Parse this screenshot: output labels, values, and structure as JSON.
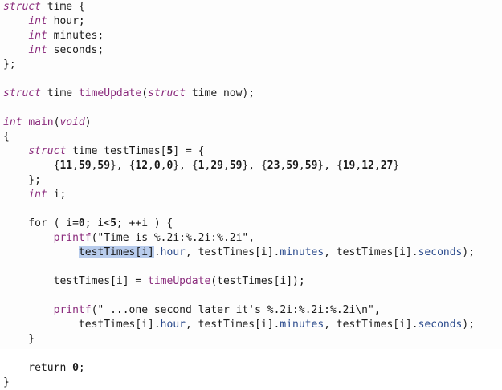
{
  "lines": [
    [
      {
        "t": "struct",
        "c": "kw"
      },
      {
        "t": " time {",
        "c": ""
      }
    ],
    [
      {
        "t": "    ",
        "c": ""
      },
      {
        "t": "int",
        "c": "kw"
      },
      {
        "t": " hour;",
        "c": ""
      }
    ],
    [
      {
        "t": "    ",
        "c": ""
      },
      {
        "t": "int",
        "c": "kw"
      },
      {
        "t": " minutes;",
        "c": ""
      }
    ],
    [
      {
        "t": "    ",
        "c": ""
      },
      {
        "t": "int",
        "c": "kw"
      },
      {
        "t": " seconds;",
        "c": ""
      }
    ],
    [
      {
        "t": "};",
        "c": ""
      }
    ],
    [],
    [
      {
        "t": "struct",
        "c": "kw"
      },
      {
        "t": " time ",
        "c": ""
      },
      {
        "t": "timeUpdate",
        "c": "fn"
      },
      {
        "t": "(",
        "c": ""
      },
      {
        "t": "struct",
        "c": "kw"
      },
      {
        "t": " time now);",
        "c": ""
      }
    ],
    [],
    [
      {
        "t": "int",
        "c": "kw"
      },
      {
        "t": " ",
        "c": ""
      },
      {
        "t": "main",
        "c": "fn"
      },
      {
        "t": "(",
        "c": ""
      },
      {
        "t": "void",
        "c": "kw"
      },
      {
        "t": ")",
        "c": ""
      }
    ],
    [
      {
        "t": "{",
        "c": ""
      }
    ],
    [
      {
        "t": "    ",
        "c": ""
      },
      {
        "t": "struct",
        "c": "kw"
      },
      {
        "t": " time testTimes[",
        "c": ""
      },
      {
        "t": "5",
        "c": "num"
      },
      {
        "t": "] = {",
        "c": ""
      }
    ],
    [
      {
        "t": "        {",
        "c": ""
      },
      {
        "t": "11",
        "c": "num"
      },
      {
        "t": ",",
        "c": ""
      },
      {
        "t": "59",
        "c": "num"
      },
      {
        "t": ",",
        "c": ""
      },
      {
        "t": "59",
        "c": "num"
      },
      {
        "t": "}, {",
        "c": ""
      },
      {
        "t": "12",
        "c": "num"
      },
      {
        "t": ",",
        "c": ""
      },
      {
        "t": "0",
        "c": "num"
      },
      {
        "t": ",",
        "c": ""
      },
      {
        "t": "0",
        "c": "num"
      },
      {
        "t": "}, {",
        "c": ""
      },
      {
        "t": "1",
        "c": "num"
      },
      {
        "t": ",",
        "c": ""
      },
      {
        "t": "29",
        "c": "num"
      },
      {
        "t": ",",
        "c": ""
      },
      {
        "t": "59",
        "c": "num"
      },
      {
        "t": "}, {",
        "c": ""
      },
      {
        "t": "23",
        "c": "num"
      },
      {
        "t": ",",
        "c": ""
      },
      {
        "t": "59",
        "c": "num"
      },
      {
        "t": ",",
        "c": ""
      },
      {
        "t": "59",
        "c": "num"
      },
      {
        "t": "}, {",
        "c": ""
      },
      {
        "t": "19",
        "c": "num"
      },
      {
        "t": ",",
        "c": ""
      },
      {
        "t": "12",
        "c": "num"
      },
      {
        "t": ",",
        "c": ""
      },
      {
        "t": "27",
        "c": "num"
      },
      {
        "t": "}",
        "c": ""
      }
    ],
    [
      {
        "t": "    };",
        "c": ""
      }
    ],
    [
      {
        "t": "    ",
        "c": ""
      },
      {
        "t": "int",
        "c": "kw"
      },
      {
        "t": " i;",
        "c": ""
      }
    ],
    [],
    [
      {
        "t": "    for ( i=",
        "c": ""
      },
      {
        "t": "0",
        "c": "num"
      },
      {
        "t": "; i<",
        "c": ""
      },
      {
        "t": "5",
        "c": "num"
      },
      {
        "t": "; ++i ) {",
        "c": ""
      }
    ],
    [
      {
        "t": "        ",
        "c": ""
      },
      {
        "t": "printf",
        "c": "fn"
      },
      {
        "t": "(\"Time is %.2i:%.2i:%.2i\",",
        "c": "str"
      }
    ],
    [
      {
        "t": "            ",
        "c": ""
      },
      {
        "t": "testTimes[i]",
        "c": "sel"
      },
      {
        "t": ".",
        "c": ""
      },
      {
        "t": "hour",
        "c": "field"
      },
      {
        "t": ", testTimes[i].",
        "c": ""
      },
      {
        "t": "minutes",
        "c": "field"
      },
      {
        "t": ", testTimes[i].",
        "c": ""
      },
      {
        "t": "seconds",
        "c": "field"
      },
      {
        "t": ");",
        "c": ""
      }
    ],
    [],
    [
      {
        "t": "        testTimes[i] = ",
        "c": ""
      },
      {
        "t": "timeUpdate",
        "c": "fn"
      },
      {
        "t": "(testTimes[i]);",
        "c": ""
      }
    ],
    [],
    [
      {
        "t": "        ",
        "c": ""
      },
      {
        "t": "printf",
        "c": "fn"
      },
      {
        "t": "(\" ...one second later it's %.2i:%.2i:%.2i\\n\",",
        "c": "str"
      }
    ],
    [
      {
        "t": "            testTimes[i].",
        "c": ""
      },
      {
        "t": "hour",
        "c": "field"
      },
      {
        "t": ", testTimes[i].",
        "c": ""
      },
      {
        "t": "minutes",
        "c": "field"
      },
      {
        "t": ", testTimes[i].",
        "c": ""
      },
      {
        "t": "seconds",
        "c": "field"
      },
      {
        "t": ");",
        "c": ""
      }
    ],
    [
      {
        "t": "    }",
        "c": ""
      }
    ],
    [],
    [
      {
        "t": "    return ",
        "c": ""
      },
      {
        "t": "0",
        "c": "num"
      },
      {
        "t": ";",
        "c": ""
      }
    ],
    [
      {
        "t": "}",
        "c": ""
      }
    ]
  ]
}
